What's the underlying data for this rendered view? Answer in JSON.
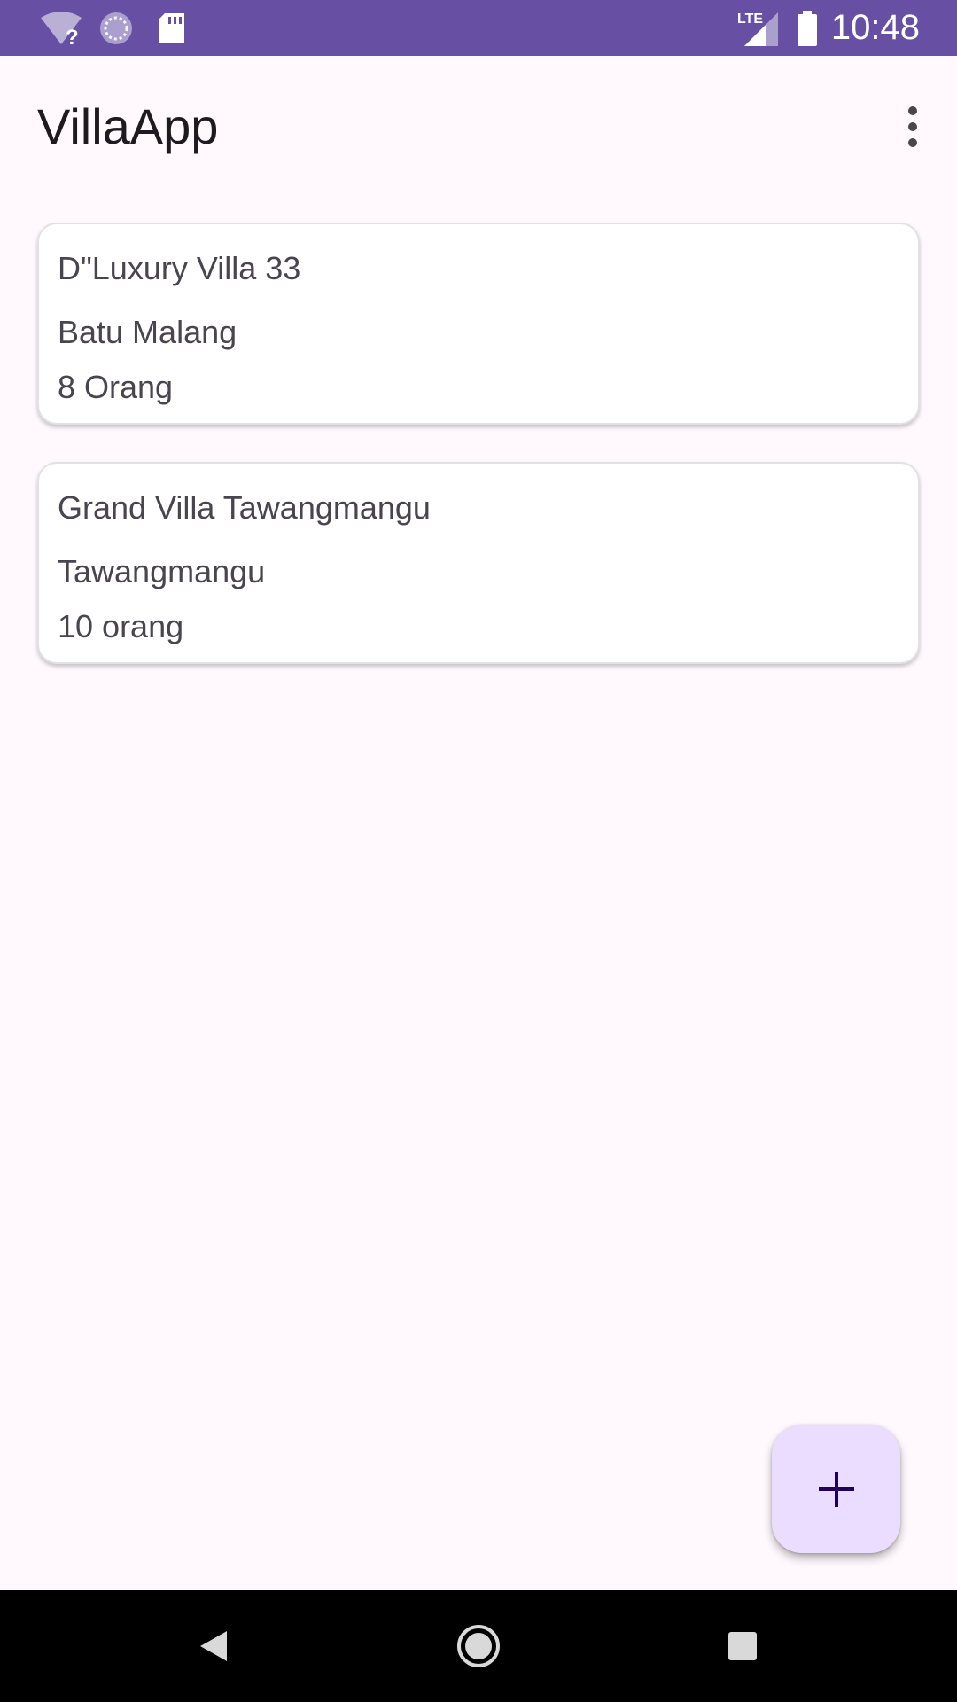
{
  "status_bar": {
    "time": "10:48",
    "network_type": "LTE",
    "icons": [
      "wifi-unknown-icon",
      "sync-icon",
      "sd-card-icon",
      "lte-signal-icon",
      "battery-icon"
    ],
    "background_color": "#6750A4"
  },
  "app_bar": {
    "title": "VillaApp",
    "overflow_icon": "more-vert-icon"
  },
  "villas": [
    {
      "name": "D\"Luxury Villa 33",
      "location": "Batu Malang",
      "capacity": "8 Orang"
    },
    {
      "name": "Grand Villa Tawangmangu",
      "location": "Tawangmangu",
      "capacity": "10 orang"
    }
  ],
  "fab": {
    "icon": "add-icon",
    "background_color": "#EADDFF"
  },
  "navigation_bar": {
    "icons": [
      "back-icon",
      "home-icon",
      "recents-icon"
    ]
  }
}
